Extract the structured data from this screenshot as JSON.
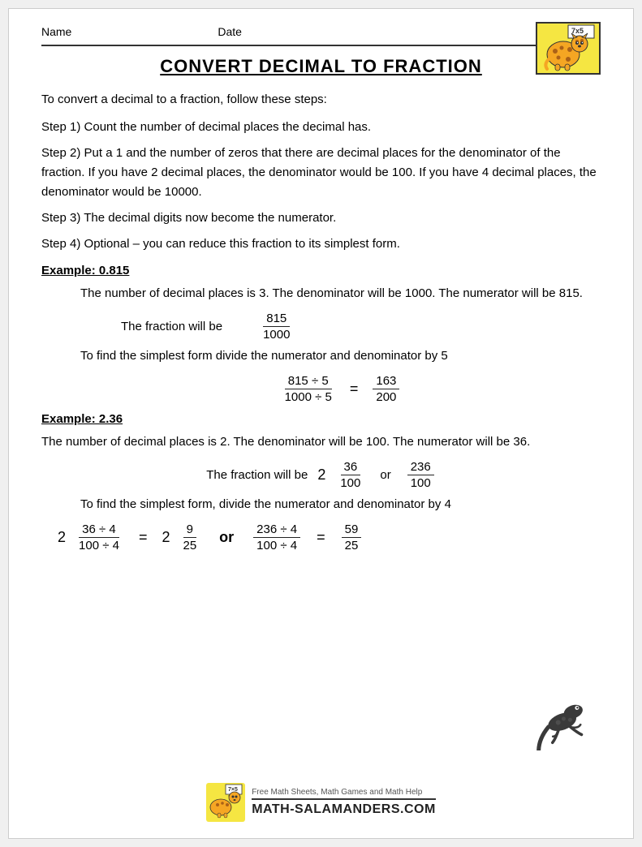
{
  "header": {
    "name_label": "Name",
    "date_label": "Date"
  },
  "title": "CONVERT DECIMAL TO FRACTION",
  "intro": "To convert a decimal to a fraction, follow these steps:",
  "steps": [
    "Step 1) Count the number of decimal places the decimal has.",
    "Step 2) Put a 1 and the number of zeros that there are decimal places for the denominator of the fraction. If you have 2 decimal places, the denominator would be 100. If you have 4 decimal places, the denominator would be 10000.",
    "Step 3) The decimal digits now become the numerator.",
    "Step 4) Optional – you can reduce this fraction to its simplest form."
  ],
  "example1": {
    "heading": "Example: 0.815",
    "text1": "The number of decimal places is 3. The denominator will be 1000. The numerator will be 815.",
    "fraction_label": "The fraction will be",
    "fraction_num": "815",
    "fraction_den": "1000",
    "simplest_text": "To find the simplest form divide the numerator and denominator by 5",
    "div_num": "815 ÷ 5",
    "div_den": "1000 ÷ 5",
    "result_num": "163",
    "result_den": "200"
  },
  "example2": {
    "heading": "Example: 2.36",
    "text1": "The number of decimal places is 2. The denominator will be 100. The numerator will be 36.",
    "fraction_label": "The fraction will be",
    "whole": "2",
    "frac_num": "36",
    "frac_den": "100",
    "or": "or",
    "alt_num": "236",
    "alt_den": "100",
    "simplest_text": "To find the simplest form, divide the numerator and denominator by 4",
    "row2_whole": "2",
    "row2_num": "36 ÷ 4",
    "row2_den": "100 ÷ 4",
    "row2_eq": "=",
    "row2_whole2": "2",
    "row2_num2": "9",
    "row2_den2": "25",
    "row2_or": "or",
    "row2_alt_num": "236 ÷ 4",
    "row2_alt_den": "100 ÷ 4",
    "row2_eq2": "=",
    "row2_final_num": "59",
    "row2_final_den": "25"
  },
  "footer": {
    "small_text": "Free Math Sheets, Math Games and Math Help",
    "site_name": "MATH-SALAMANDERS.COM"
  }
}
